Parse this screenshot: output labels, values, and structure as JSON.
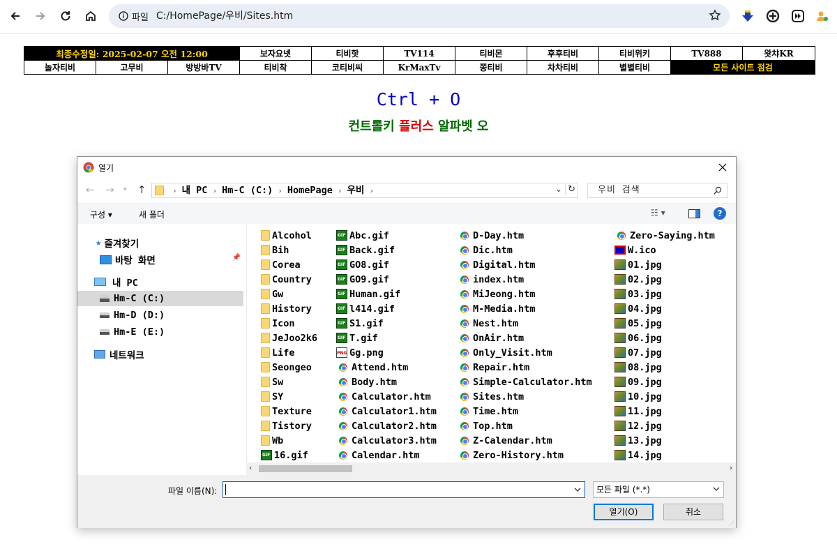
{
  "browser": {
    "site_info_label": "파일",
    "url": "C:/HomePage/우비/Sites.htm"
  },
  "sites": {
    "row1": [
      {
        "label": "최종수정일: 2025-02-07 오전 12:00",
        "style": "black"
      },
      {
        "label": "보자요넷"
      },
      {
        "label": "티비핫"
      },
      {
        "label": "TV114"
      },
      {
        "label": "티비몬"
      },
      {
        "label": "후후티비"
      },
      {
        "label": "티비위키"
      },
      {
        "label": "TV888"
      },
      {
        "label": "왓챠KR"
      }
    ],
    "row2": [
      {
        "label": "놀자티비"
      },
      {
        "label": "고무비"
      },
      {
        "label": "방방바TV"
      },
      {
        "label": "티비착"
      },
      {
        "label": "코티비씨"
      },
      {
        "label": "KrMaxTv"
      },
      {
        "label": "쫑티비"
      },
      {
        "label": "차차티비"
      },
      {
        "label": "별별티비"
      },
      {
        "label": "모든 사이트 점검",
        "style": "black"
      }
    ]
  },
  "hint": {
    "title": "Ctrl + O",
    "sub_part1": "컨트롤키 ",
    "sub_part2": "플러스",
    "sub_part3": " 알파벳 오"
  },
  "dialog": {
    "title": "열기",
    "crumbs": [
      "내 PC",
      "Hm-C (C:)",
      "HomePage",
      "우비"
    ],
    "search_placeholder": "우비 검색",
    "toolbar": {
      "organize": "구성 ▾",
      "new_folder": "새 폴더"
    },
    "nav": {
      "favorites": "즐겨찾기",
      "desktop": "바탕 화면",
      "my_pc": "내 PC",
      "drive_c": "Hm-C (C:)",
      "drive_d": "Hm-D (D:)",
      "drive_e": "Hm-E (E:)",
      "network": "네트워크"
    },
    "columns": [
      [
        {
          "name": "Alcohol",
          "type": "folder"
        },
        {
          "name": "Bih",
          "type": "folder"
        },
        {
          "name": "Corea",
          "type": "folder"
        },
        {
          "name": "Country",
          "type": "folder"
        },
        {
          "name": "Gw",
          "type": "folder"
        },
        {
          "name": "History",
          "type": "folder"
        },
        {
          "name": "Icon",
          "type": "folder"
        },
        {
          "name": "JeJoo2k6",
          "type": "folder"
        },
        {
          "name": "Life",
          "type": "folder"
        },
        {
          "name": "Seongeo",
          "type": "folder"
        },
        {
          "name": "Sw",
          "type": "folder"
        },
        {
          "name": "SY",
          "type": "folder"
        },
        {
          "name": "Texture",
          "type": "folder"
        },
        {
          "name": "Tistory",
          "type": "folder"
        },
        {
          "name": "Wb",
          "type": "folder"
        },
        {
          "name": "16.gif",
          "type": "gif"
        }
      ],
      [
        {
          "name": "Abc.gif",
          "type": "gif"
        },
        {
          "name": "Back.gif",
          "type": "gif"
        },
        {
          "name": "GO8.gif",
          "type": "gif"
        },
        {
          "name": "GO9.gif",
          "type": "gif"
        },
        {
          "name": "Human.gif",
          "type": "gif"
        },
        {
          "name": "l414.gif",
          "type": "gif"
        },
        {
          "name": "S1.gif",
          "type": "gif"
        },
        {
          "name": "T.gif",
          "type": "gif"
        },
        {
          "name": "Gg.png",
          "type": "png"
        },
        {
          "name": "Attend.htm",
          "type": "htm"
        },
        {
          "name": "Body.htm",
          "type": "htm"
        },
        {
          "name": "Calculator.htm",
          "type": "htm"
        },
        {
          "name": "Calculator1.htm",
          "type": "htm"
        },
        {
          "name": "Calculator2.htm",
          "type": "htm"
        },
        {
          "name": "Calculator3.htm",
          "type": "htm"
        },
        {
          "name": "Calendar.htm",
          "type": "htm"
        }
      ],
      [
        {
          "name": "D-Day.htm",
          "type": "htm"
        },
        {
          "name": "Dic.htm",
          "type": "htm"
        },
        {
          "name": "Digital.htm",
          "type": "htm"
        },
        {
          "name": "index.htm",
          "type": "htm"
        },
        {
          "name": "MiJeong.htm",
          "type": "htm"
        },
        {
          "name": "M-Media.htm",
          "type": "htm"
        },
        {
          "name": "Nest.htm",
          "type": "htm"
        },
        {
          "name": "OnAir.htm",
          "type": "htm"
        },
        {
          "name": "Only_Visit.htm",
          "type": "htm"
        },
        {
          "name": "Repair.htm",
          "type": "htm"
        },
        {
          "name": "Simple-Calculator.htm",
          "type": "htm"
        },
        {
          "name": "Sites.htm",
          "type": "htm"
        },
        {
          "name": "Time.htm",
          "type": "htm"
        },
        {
          "name": "Top.htm",
          "type": "htm"
        },
        {
          "name": "Z-Calendar.htm",
          "type": "htm"
        },
        {
          "name": "Zero-History.htm",
          "type": "htm"
        }
      ],
      [
        {
          "name": "Zero-Saying.htm",
          "type": "htm"
        },
        {
          "name": "W.ico",
          "type": "ico"
        },
        {
          "name": "01.jpg",
          "type": "jpg"
        },
        {
          "name": "02.jpg",
          "type": "jpg"
        },
        {
          "name": "03.jpg",
          "type": "jpg"
        },
        {
          "name": "04.jpg",
          "type": "jpg"
        },
        {
          "name": "05.jpg",
          "type": "jpg"
        },
        {
          "name": "06.jpg",
          "type": "jpg"
        },
        {
          "name": "07.jpg",
          "type": "jpg"
        },
        {
          "name": "08.jpg",
          "type": "jpg"
        },
        {
          "name": "09.jpg",
          "type": "jpg"
        },
        {
          "name": "10.jpg",
          "type": "jpg"
        },
        {
          "name": "11.jpg",
          "type": "jpg"
        },
        {
          "name": "12.jpg",
          "type": "jpg"
        },
        {
          "name": "13.jpg",
          "type": "jpg"
        },
        {
          "name": "14.jpg",
          "type": "jpg"
        }
      ]
    ],
    "filename_label": "파일 이름(N):",
    "filename_value": "",
    "file_type": "모든 파일 (*.*)",
    "open_button": "열기(O)",
    "cancel_button": "취소"
  }
}
